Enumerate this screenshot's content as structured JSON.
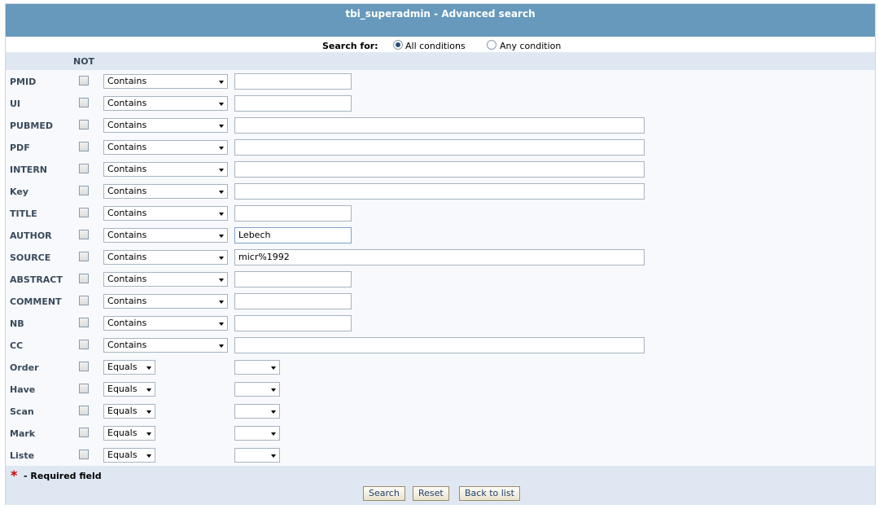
{
  "title": "tbi_superadmin - Advanced search",
  "search_for": {
    "label": "Search for:",
    "options": [
      {
        "label": "All conditions",
        "checked": true
      },
      {
        "label": "Any condition",
        "checked": false
      }
    ]
  },
  "not_label": "NOT",
  "fields": [
    {
      "label": "PMID",
      "operator": "Contains",
      "value": "",
      "input": "short"
    },
    {
      "label": "UI",
      "operator": "Contains",
      "value": "",
      "input": "short"
    },
    {
      "label": "PUBMED",
      "operator": "Contains",
      "value": "",
      "input": "long"
    },
    {
      "label": "PDF",
      "operator": "Contains",
      "value": "",
      "input": "long"
    },
    {
      "label": "INTERN",
      "operator": "Contains",
      "value": "",
      "input": "long"
    },
    {
      "label": "Key",
      "operator": "Contains",
      "value": "",
      "input": "long"
    },
    {
      "label": "TITLE",
      "operator": "Contains",
      "value": "",
      "input": "short"
    },
    {
      "label": "AUTHOR",
      "operator": "Contains",
      "value": "Lebech",
      "input": "short"
    },
    {
      "label": "SOURCE",
      "operator": "Contains",
      "value": "micr%1992",
      "input": "long"
    },
    {
      "label": "ABSTRACT",
      "operator": "Contains",
      "value": "",
      "input": "short"
    },
    {
      "label": "COMMENT",
      "operator": "Contains",
      "value": "",
      "input": "short"
    },
    {
      "label": "NB",
      "operator": "Contains",
      "value": "",
      "input": "short"
    },
    {
      "label": "CC",
      "operator": "Contains",
      "value": "",
      "input": "long"
    },
    {
      "label": "Order",
      "operator": "Equals",
      "value": "",
      "input": "select"
    },
    {
      "label": "Have",
      "operator": "Equals",
      "value": "",
      "input": "select"
    },
    {
      "label": "Scan",
      "operator": "Equals",
      "value": "",
      "input": "select"
    },
    {
      "label": "Mark",
      "operator": "Equals",
      "value": "",
      "input": "select"
    },
    {
      "label": "Liste",
      "operator": "Equals",
      "value": "",
      "input": "select"
    }
  ],
  "footer": {
    "required_star": "*",
    "required_text": "- Required field",
    "buttons": {
      "search": "Search",
      "reset": "Reset",
      "back": "Back to list"
    }
  },
  "colors": {
    "header": "#6699bb",
    "band": "#dfe8f2",
    "required": "#cc0000"
  }
}
